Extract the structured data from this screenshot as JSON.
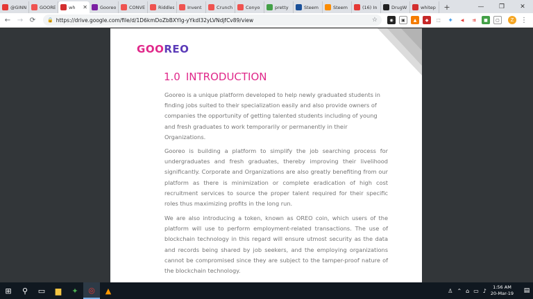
{
  "browser": {
    "tabs": [
      {
        "label": "@GINN",
        "favicon": "pdf",
        "color": "#e53935",
        "active": false
      },
      {
        "label": "GOOREO",
        "favicon": "steemit",
        "color": "#ef5350",
        "active": false
      },
      {
        "label": "wh",
        "favicon": "pdf",
        "color": "#d32f2f",
        "active": true
      },
      {
        "label": "Gooreo",
        "favicon": "link",
        "color": "#7b1fa2",
        "active": false
      },
      {
        "label": "CONVE",
        "favicon": "steemit",
        "color": "#ef5350",
        "active": false
      },
      {
        "label": "Riddles",
        "favicon": "steemit",
        "color": "#ef5350",
        "active": false
      },
      {
        "label": "Invent",
        "favicon": "steemit",
        "color": "#ef5350",
        "active": false
      },
      {
        "label": "Crunch",
        "favicon": "steemit",
        "color": "#ef5350",
        "active": false
      },
      {
        "label": "Conyo",
        "favicon": "steemit",
        "color": "#ef5350",
        "active": false
      },
      {
        "label": "pretty",
        "favicon": "green",
        "color": "#43a047",
        "active": false
      },
      {
        "label": "Steem",
        "favicon": "steem",
        "color": "#1a5099",
        "active": false
      },
      {
        "label": "Steem",
        "favicon": "smile",
        "color": "#fb8c00",
        "active": false
      },
      {
        "label": "(16) In",
        "favicon": "youtube",
        "color": "#e53935",
        "active": false
      },
      {
        "label": "DrugW",
        "favicon": "dw",
        "color": "#212121",
        "active": false
      },
      {
        "label": "whitep",
        "favicon": "pdf",
        "color": "#d32f2f",
        "active": false
      }
    ],
    "close_glyph": "✕",
    "new_tab_glyph": "+",
    "window_controls": [
      "—",
      "❐",
      "✕"
    ],
    "url": "https://drive.google.com/file/d/1D6kmDoZbBXYIg-yYkdI32yLVNdjfCv89/view",
    "profile_initial": "Z"
  },
  "document": {
    "logo_text": {
      "g": "G",
      "oo": "OO",
      "reo": "REO"
    },
    "section_number": "1.0",
    "section_title": "INTRODUCTION",
    "paragraphs": [
      " Gooreo is a unique platform developed to help newly graduated students in finding jobs suited to their specialization easily and also provide owners of companies the opportunity of getting talented students including of young and fresh graduates to work temporarily or permanently in their Organizations.",
      "Gooreo is building a platform to simplify the job searching process for undergraduates and fresh graduates, thereby improving their livelihood significantly. Corporate and Organizations are also  greatly benefiting from our platform as there is minimization or complete eradication of high cost recruitment services to source the proper talent required for their specific roles thus maximizing profits in the long run.",
      "We are also introducing a token, known as OREO coin, which users of the platform will use to perform employment-related transactions. The use of blockchain technology in this regard will ensure utmost security as the data and records being shared by job seekers, and the employing organizations cannot be compromised since they are subject to the tamper-proof nature of the blockchain technology."
    ],
    "colors": {
      "accent": "#e0288a",
      "brand_purple": "#5b3bb8",
      "body_text": "#757575"
    }
  },
  "taskbar": {
    "time": "1:56 AM",
    "date": "20-Mar-19"
  }
}
